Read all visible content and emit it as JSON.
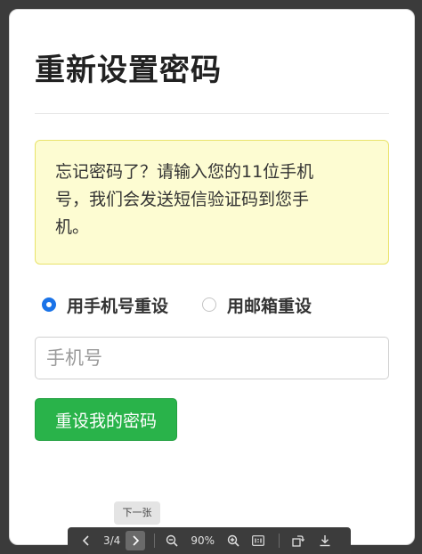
{
  "form": {
    "title": "重新设置密码",
    "notice": "忘记密码了？请输入您的11位手机号，我们会发送短信验证码到您手机。",
    "radio_options": [
      {
        "label": "用手机号重设",
        "checked": true
      },
      {
        "label": "用邮箱重设",
        "checked": false
      }
    ],
    "phone_placeholder": "手机号",
    "phone_value": "",
    "submit_label": "重设我的密码"
  },
  "viewer": {
    "tooltip": "下一张",
    "page_indicator": "3/4",
    "zoom_level": "90%",
    "icons": [
      "chevron-left-icon",
      "chevron-right-icon",
      "zoom-out-icon",
      "zoom-in-icon",
      "actual-size-icon",
      "rotate-icon",
      "download-icon"
    ]
  },
  "colors": {
    "accent": "#1a73e8",
    "submit_bg": "#29b34a",
    "notice_bg": "#fdfcd2",
    "notice_border": "#e9e36a"
  }
}
